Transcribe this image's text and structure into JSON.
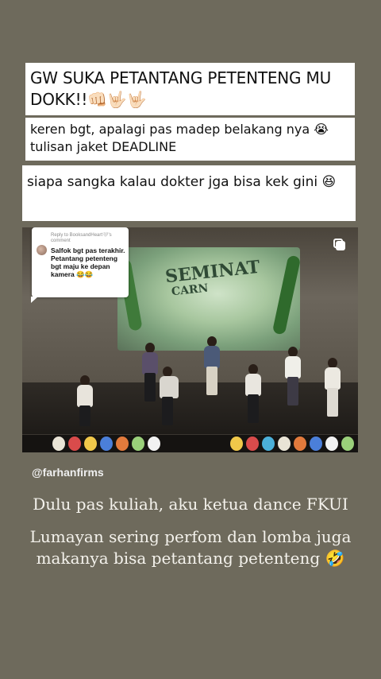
{
  "captions": {
    "first": "GW SUKA PETANTANG PETENTENG MU DOKK!!👊🏻🤟🏻🤟🏻",
    "second": "keren bgt, apalagi pas madep belakang nya 😭 tulisan jaket DEADLINE",
    "third": "siapa sangka kalau dokter jga bisa kek gini 😆"
  },
  "video": {
    "screen_text_line1": "SEMINAT",
    "screen_text_line2": "CARN",
    "reply": {
      "header": "Reply to BooksandHeart🤍's comment",
      "body": "Salfok bgt pas terakhir. Petantang petenteng bgt maju ke depan kamera 😂😂"
    },
    "multi_icon": "multiple-posts-icon",
    "colors": {
      "balloons": [
        "#e9e4d6",
        "#d94b4b",
        "#f0c84a",
        "#4b7fd9",
        "#e27a3c",
        "#9ad07a",
        "#f2f2f2",
        "#4bb0d9"
      ]
    }
  },
  "handle": "@farhanfirms",
  "story_text": {
    "line1": "Dulu pas kuliah, aku ketua dance FKUI",
    "line2": "Lumayan sering perfom dan lomba juga makanya bisa petantang petenteng 🤣"
  },
  "colors": {
    "background": "#6e6a5c",
    "caption_bg": "#ffffff",
    "text_light": "#f4f2ec"
  }
}
